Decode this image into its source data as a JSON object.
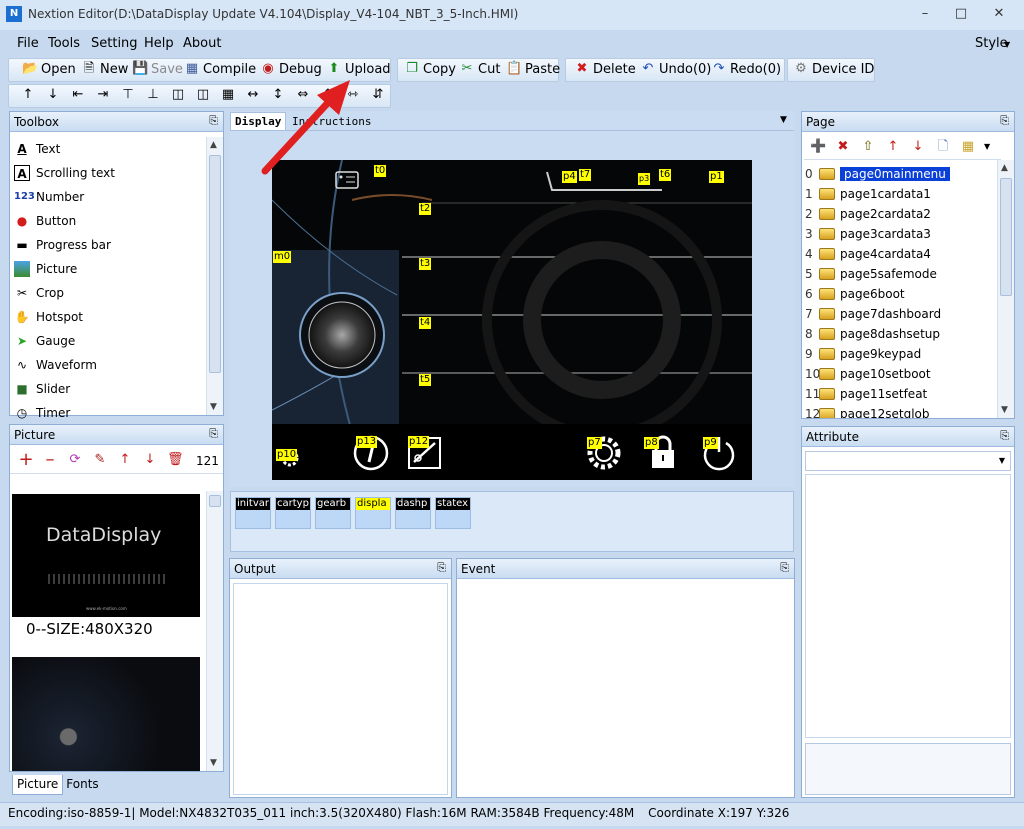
{
  "window": {
    "title": "Nextion Editor(D:\\DataDisplay Update V4.104\\Display_V4-104_NBT_3_5-Inch.HMI)",
    "icon": "N"
  },
  "menu": [
    "File",
    "Tools",
    "Setting",
    "Help",
    "About"
  ],
  "style_menu": "Style",
  "toolbar": {
    "open": "Open",
    "new": "New",
    "save": "Save",
    "compile": "Compile",
    "debug": "Debug",
    "upload": "Upload",
    "copy": "Copy",
    "cut": "Cut",
    "paste": "Paste",
    "delete": "Delete",
    "undo": "Undo(0)",
    "redo": "Redo(0)",
    "device_id": "Device  ID"
  },
  "toolbox": {
    "title": "Toolbox",
    "items": [
      "Text",
      "Scrolling text",
      "Number",
      "Button",
      "Progress bar",
      "Picture",
      "Crop",
      "Hotspot",
      "Gauge",
      "Waveform",
      "Slider",
      "Timer"
    ]
  },
  "picture_panel": {
    "title": "Picture",
    "count": "121",
    "preview_brand": "DataDisplay",
    "preview_url": "www.ek-motion.com",
    "size_label": "0--SIZE:480X320"
  },
  "bottom_tabs": [
    "Picture",
    "Fonts"
  ],
  "editor_tabs": [
    "Display",
    "Instructions"
  ],
  "screen_labels": [
    "t0",
    "p4",
    "t7",
    "p3",
    "t6",
    "p1",
    "t2",
    "m0",
    "t3",
    "t4",
    "t5",
    "p10",
    "p13",
    "p12",
    "p7",
    "p8",
    "p9"
  ],
  "timers": [
    "initvar",
    "cartyp",
    "gearb",
    "displa",
    "dashp",
    "statex"
  ],
  "output_panel": {
    "title": "Output"
  },
  "event_panel": {
    "title": "Event"
  },
  "page_panel": {
    "title": "Page",
    "pages": [
      "page0mainmenu",
      "page1cardata1",
      "page2cardata2",
      "page3cardata3",
      "page4cardata4",
      "page5safemode",
      "page6boot",
      "page7dashboard",
      "page8dashsetup",
      "page9keypad",
      "page10setboot",
      "page11setfeat",
      "page12setglob"
    ],
    "page_numbers": [
      "0",
      "1",
      "2",
      "3",
      "4",
      "5",
      "6",
      "7",
      "8",
      "9",
      "10",
      "11",
      "12"
    ]
  },
  "attribute_panel": {
    "title": "Attribute"
  },
  "status": {
    "encoding": "Encoding:iso-8859-1",
    "model": "Model:NX4832T035_011",
    "inch": "inch:3.5(320X480)",
    "flash": "Flash:16M",
    "ram": "RAM:3584B",
    "freq": "Frequency:48M",
    "coord": "Coordinate X:197  Y:326"
  }
}
